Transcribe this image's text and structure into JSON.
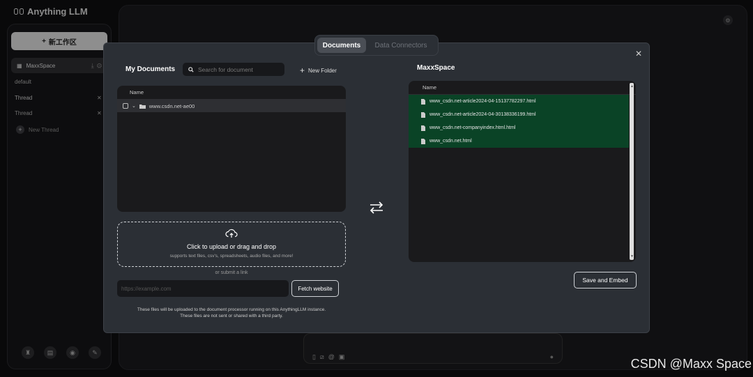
{
  "app": {
    "logo_text": "Anything LLM"
  },
  "sidebar": {
    "new_workspace_label": "新工作区",
    "workspace_name": "MaxxSpace",
    "threads": [
      {
        "label": "default"
      },
      {
        "label": "Thread"
      },
      {
        "label": "Thread"
      }
    ],
    "new_thread_label": "New Thread"
  },
  "modal": {
    "tabs": {
      "documents": "Documents",
      "data_connectors": "Data Connectors"
    },
    "my_documents_title": "My Documents",
    "search_placeholder": "Search for document",
    "new_folder_label": "New Folder",
    "file_column_header": "Name",
    "folder_name": "www.csdn.net-ae00",
    "upload_main": "Click to upload or drag and drop",
    "upload_sub": "supports text files, csv's, spreadsheets, audio files, and more!",
    "or_link": "or submit a link",
    "link_placeholder": "https://example.com",
    "fetch_label": "Fetch website",
    "disclaimer_line1": "These files will be uploaded to the document processor running on this AnythingLLM instance.",
    "disclaimer_line2": "These files are not sent or shared with a third party.",
    "workspace_title": "MaxxSpace",
    "workspace_column_header": "Name",
    "workspace_files": [
      "www_csdn.net-article2024-04-15137782297.html",
      "www_csdn.net-article2024-04-30138336199.html",
      "www_csdn.net-companyindex.html.html",
      "www_csdn.net.html"
    ],
    "save_label": "Save and Embed"
  },
  "watermark": "CSDN @Maxx Space",
  "colors": {
    "modal_bg": "#2b2f35",
    "selected_file_bg": "#0a4326"
  }
}
